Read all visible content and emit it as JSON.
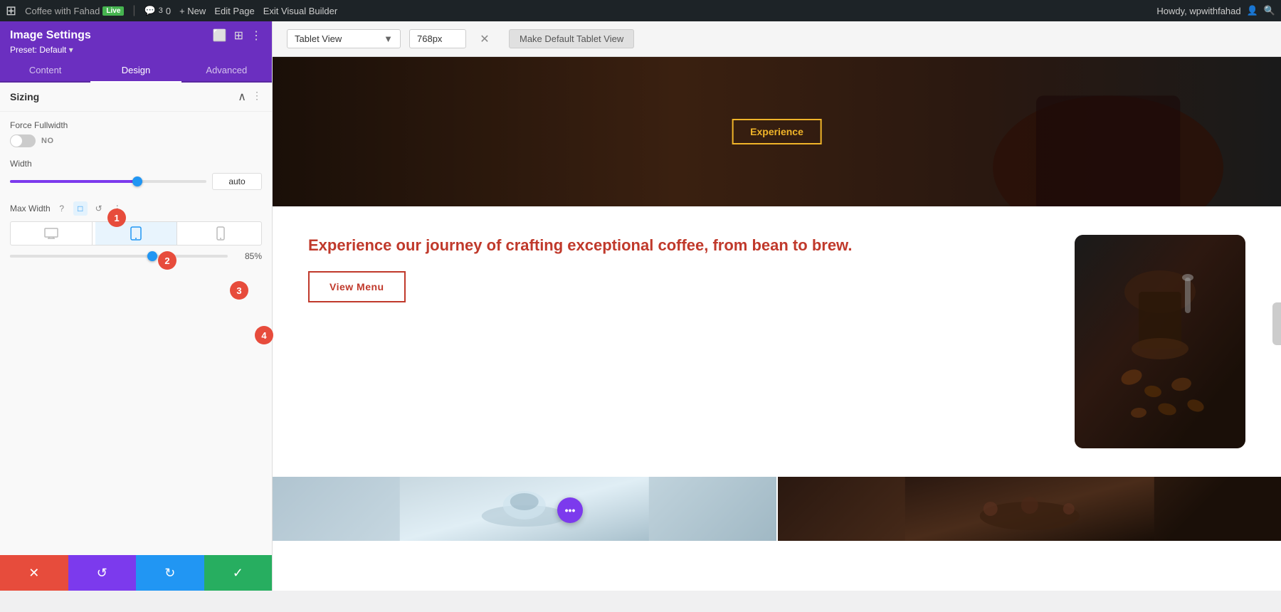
{
  "adminBar": {
    "logoIcon": "W",
    "siteName": "Coffee with Fahad",
    "liveBadge": "Live",
    "commentCount": "3",
    "commentIcon": "💬",
    "commentBadge": "0",
    "newLabel": "+ New",
    "editPageLabel": "Edit Page",
    "exitBuilderLabel": "Exit Visual Builder",
    "greetingText": "Howdy, wpwithfahad",
    "searchIcon": "🔍",
    "avatarIcon": "👤"
  },
  "panel": {
    "title": "Image Settings",
    "presetLabel": "Preset:",
    "presetValue": "Default",
    "headerIcons": [
      "⬜",
      "⊞",
      "⋮"
    ],
    "tabs": [
      {
        "label": "Content",
        "id": "content",
        "active": false
      },
      {
        "label": "Design",
        "id": "design",
        "active": true
      },
      {
        "label": "Advanced",
        "id": "advanced",
        "active": false
      }
    ],
    "sizingSection": {
      "title": "Sizing",
      "collapsed": false,
      "forceFullwidth": {
        "label": "Force Fullwidth",
        "toggleValue": "NO"
      },
      "width": {
        "label": "Width",
        "value": "auto",
        "sliderPercent": 65
      },
      "maxWidth": {
        "label": "Max Width",
        "sliderPercent": 85,
        "pctValue": "85%",
        "icons": [
          "?",
          "□",
          "↺",
          "⋮"
        ]
      }
    }
  },
  "bottomBar": {
    "closeIcon": "✕",
    "undoIcon": "↺",
    "redoIcon": "↻",
    "saveIcon": "✓"
  },
  "tabletBar": {
    "viewLabel": "Tablet View",
    "pxValue": "768px",
    "closeIcon": "✕",
    "makeDefaultLabel": "Make Default Tablet View"
  },
  "preview": {
    "heroOverlayText": "Experience",
    "tagline": "Experience our journey of crafting exceptional coffee, from bean to brew.",
    "viewMenuLabel": "View Menu",
    "purpleDotsLabel": "•••"
  },
  "badges": {
    "badge1": "1",
    "badge2": "2",
    "badge3": "3",
    "badge4": "4"
  }
}
